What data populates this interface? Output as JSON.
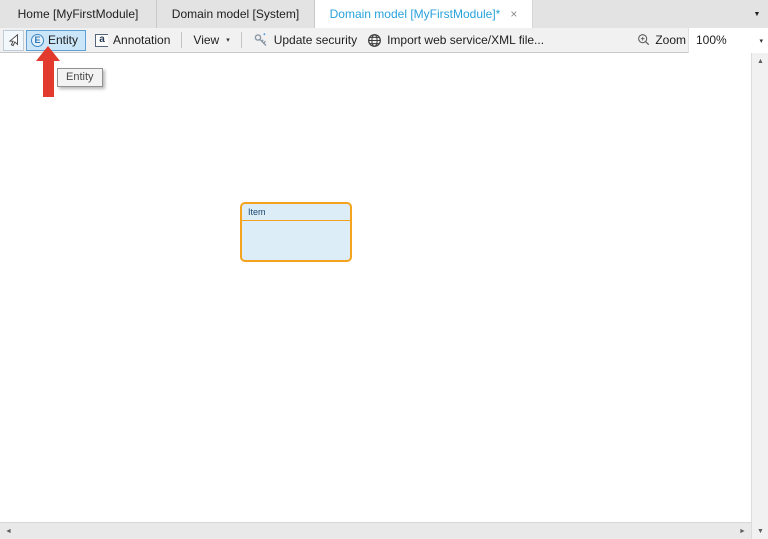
{
  "tab_bar": {
    "tabs": [
      {
        "label": "Home [MyFirstModule]"
      },
      {
        "label": "Domain model [System]"
      },
      {
        "label": "Domain model [MyFirstModule]*",
        "close_icon": "×"
      }
    ],
    "overflow_icon": "▼"
  },
  "toolbar": {
    "entity": {
      "icon_letter": "E",
      "label": "Entity"
    },
    "annotation": {
      "icon_letter": "a",
      "label": "Annotation"
    },
    "view": {
      "label": "View",
      "dropdown_icon": "▾"
    },
    "update_security": {
      "label": "Update security"
    },
    "import_ws": {
      "label": "Import web service/XML file..."
    },
    "zoom": {
      "label": "Zoom",
      "value": "100%",
      "dropdown_icon": "▾"
    }
  },
  "tooltip": {
    "text": "Entity"
  },
  "canvas": {
    "entities": [
      {
        "name": "Item"
      }
    ]
  },
  "scrollbars": {
    "up_icon": "▲",
    "down_icon": "▼",
    "left_icon": "◄",
    "right_icon": "►"
  },
  "colors": {
    "active_tab_text": "#28a2dc",
    "toolbar_bg": "#f1f1f1",
    "tab_bar_bg": "#e3e3e3",
    "entity_button_bg": "#cbe6f8",
    "entity_button_border": "#5fa0d5",
    "entity_box_border": "#f5a31f",
    "entity_box_fill": "#dcedf7",
    "entity_name_text": "#17456e",
    "pointer_arrow": "#e23b2e"
  }
}
